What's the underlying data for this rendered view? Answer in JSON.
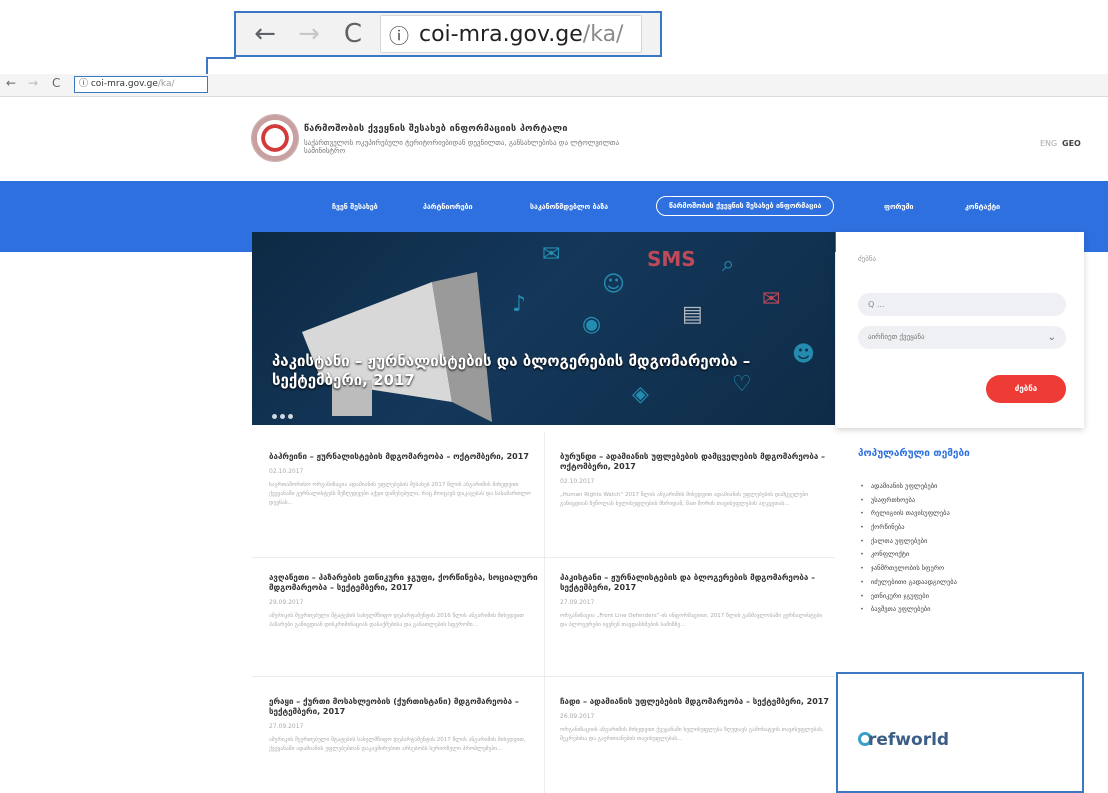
{
  "zoom_callout": {
    "back": "←",
    "forward": "→",
    "reload": "C",
    "info_icon": "ⓘ",
    "url_domain": "coi-mra.gov.ge",
    "url_path": "/ka/"
  },
  "browser": {
    "back": "←",
    "forward": "→",
    "reload": "C",
    "url_domain": "ⓘ coi-mra.gov.ge",
    "url_path": "/ka/"
  },
  "header": {
    "title": "წარმოშობის ქვეყნის შესახებ ინფორმაციის პორტალი",
    "subtitle": "საქართველოს ოკუპირებული ტერიტორიებიდან დევნილთა, განსახლებისა და ლტოლვილთა სამინისტრო",
    "lang_en": "ENG",
    "lang_ka": "GEO"
  },
  "nav": {
    "items": [
      "ჩვენ შესახებ",
      "პარტნიორები",
      "საკანონმდებლო ბაზა",
      "წარმოშობის ქვეყნის შესახებ ინფორმაცია",
      "ფორუმი",
      "კონტაქტი"
    ]
  },
  "hero": {
    "caption": "პაკისტანი – ჟურნალისტების და ბლოგერების მდგომარეობა – სექტემბერი, 2017"
  },
  "search": {
    "label": "ძებნა",
    "placeholder": "Q ...",
    "select_value": "აირჩიეთ ქვეყანა",
    "button": "ძებნა"
  },
  "articles": [
    {
      "title": "ბაჰრეინი – ჟურნალისტების მდგომარეობა – ოქტომბერი, 2017",
      "date": "02.10.2017",
      "excerpt": "საერთაშორისო ორგანიზაცია ადამიანის უფლებების შესახებ 2017 წლის ანგარიშის მიხედვით ქვეყანაში ჟურნალისტებს შეზღუდვები აქვთ დაწესებული, რაც მოიცავს დაკავებას და სასამართლო დევნას..."
    },
    {
      "title": "ბურუნდი – ადამიანის უფლებების დამცველების მდგომარეობა – ოქტომბერი, 2017",
      "date": "02.10.2017",
      "excerpt": "„Human Rights Watch“ 2017 წლის ანგარიშის მიხედვით ადამიანის უფლებების დამცველები განიცდიან ზეწოლას ხელისუფლების მხრიდან, მათ შორის თავისუფლების აღკვეთას..."
    },
    {
      "title": "ავღანეთი – ჰაზარების ეთნიკური ჯგუფი, ქორწინება, სოციალური მდგომარეობა – სექტემბერი, 2017",
      "date": "29.09.2017",
      "excerpt": "ამერიკის შეერთებული შტატების სახელმწიფო დეპარტამენტის 2016 წლის ანგარიშის მიხედვით ჰაზარები განიცდიან დისკრიმინაციას დასაქმებისა და განათლების სფეროში..."
    },
    {
      "title": "პაკისტანი – ჟურნალისტების და ბლოგერების მდგომარეობა – სექტემბერი, 2017",
      "date": "27.09.2017",
      "excerpt": "ორგანიზაცია „Front Line Defenders“-ის ინფორმაციით, 2017 წლის განმავლობაში ჟურნალისტები და ბლოგერები იყვნენ თავდასხმების სამიზნე..."
    },
    {
      "title": "ერაყი – ქურთი მოსახლეობის (ქურთისტანი) მდგომარეობა – სექტემბერი, 2017",
      "date": "27.09.2017",
      "excerpt": "ამერიკის შეერთებული შტატების სახელმწიფო დეპარტამენტის 2017 წლის ანგარიშის მიხედვით, ქვეყანაში ადამიანის უფლებებთან დაკავშირებით არსებობს სერიოზული პრობლემები..."
    },
    {
      "title": "ჩადი – ადამიანის უფლებების მდგომარეობა – სექტემბერი, 2017",
      "date": "26.09.2017",
      "excerpt": "ორგანიზაციის ანგარიშის მიხედვით ქვეყანაში ხელისუფლება ზღუდავს გამოხატვის თავისუფლებას, შეკრებისა და გაერთიანების თავისუფლებას..."
    }
  ],
  "sidebar": {
    "topics_title": "პოპულარული თემები",
    "topics": [
      "ადამიანის უფლებები",
      "უსაფრთხოება",
      "რელიგიის თავისუფლება",
      "ქორწინება",
      "ქალთა უფლებები",
      "კონფლიქტი",
      "ჯანმრთელობის სფერო",
      "იძულებითი გადაადგილება",
      "ეთნიკური ჯგუფები",
      "ბავშვთა უფლებები"
    ],
    "refworld": "refworld"
  },
  "colors": {
    "nav_blue": "#2e70e0",
    "button_red": "#ee3b36",
    "callout_blue": "#3a78c3"
  }
}
